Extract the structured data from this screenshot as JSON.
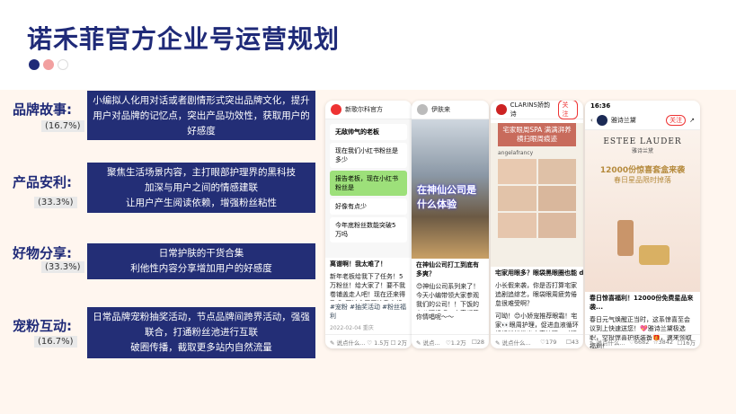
{
  "title": "诺禾菲官方企业号运营规划",
  "accent": {
    "navy": "#232e76",
    "dot1": "#1f2a78",
    "dot2": "#f2a0a0",
    "dot3": "#ffffff"
  },
  "strategies": [
    {
      "label": "品牌故事:",
      "pct": "(16.7%)",
      "desc": [
        "小编拟人化用对话或者剧情形式突出品牌文化，提升用户对品牌的记忆点，突出产品功效性，获取用户的好感度"
      ]
    },
    {
      "label": "产品安利:",
      "pct": "(33.3%)",
      "desc": [
        "聚焦生活场景内容，主打眼部护理界的黑科技",
        "加深与用户之间的情感建联",
        "让用户产生阅读依赖，增强粉丝粘性"
      ]
    },
    {
      "label": "好物分享:",
      "pct": "(33.3%)",
      "desc": [
        "日常护肤的干货合集",
        "利他性内容分享增加用户的好感度"
      ]
    },
    {
      "label": "宠粉互动:",
      "pct": "(16.7%)",
      "desc": [
        "日常品牌宠粉抽奖活动，节点品牌间跨界活动，强强联合，打通粉丝池进行互联",
        "破圈传播，截取更多站内自然流量"
      ]
    }
  ],
  "screens": [
    {
      "account": "新歌尔科官方",
      "chats": [
        "无敌帅气的老板",
        "现在我们小红书粉丝是多少",
        "报告老板，现在小红书粉丝是",
        "好像有点少",
        "今年底粉丝数能突破5万吗"
      ],
      "post_title": "离谱啊！我太难了！",
      "post_text": "新年老板给我下了任务！5万粉丝！给大家了！要不我卷铺盖走人吧！现在还来得及😭 不过今天开始我会努力给大家宠粉啦！",
      "tags": "#宠粉  #抽奖活动  #粉丝福利",
      "date": "2022-02-04 重庆",
      "likes": "1.5万",
      "comments": "2万"
    },
    {
      "account": "伊肤来",
      "overlay": "在神仙公司是什么体验",
      "post_title": "在神仙公司打工到底有多爽？",
      "post_text": "😊神仙公司系列来了！今天小编带领大家参观我们的公司！！下饭的办公环境呢，大家都羡慕吗？！",
      "more": "你情唱呢～～",
      "likes": "1.2万",
      "comments": "28"
    },
    {
      "account": "CLARINS娇韵诗",
      "follow": "关注",
      "banner": "宅家眼周SPA 满满湃养横扫眼周痕迹",
      "author": "angelafrancy",
      "post_title": "宅家用眼多？眼袋黑眼圈也能 double kill",
      "post_text": "小长假来袭，你是否打算宅家追剧追综艺，眼袋眼周疲劳倦怠很难受啊？",
      "more": "可呦！😊小娇宠推荐眼霜！宅家👀眼周护理，促进血液循环轻轻松松做出宅家护理，对眼睛大家都爱心中～",
      "likes": "179",
      "comments": "43"
    },
    {
      "account": "雅诗兰黛",
      "follow": "关注",
      "time": "16:36",
      "brand": "ESTEE LAUDER",
      "brand_cn": "雅诗兰黛",
      "promo1": "12000份惊喜套盒来袭",
      "promo2": "春日星品限时掉落",
      "post_title": "春日惊喜福利！12000份免费星品来袭...",
      "post_text": "春日元气焕醒正当时，这系惊喜至会议到上快速送您！💖雅诗兰黛极选职，空投惊喜护肤装备🎁，速来领取福利！",
      "likes": "6682",
      "comments": "3842",
      "shares": "16万"
    }
  ]
}
